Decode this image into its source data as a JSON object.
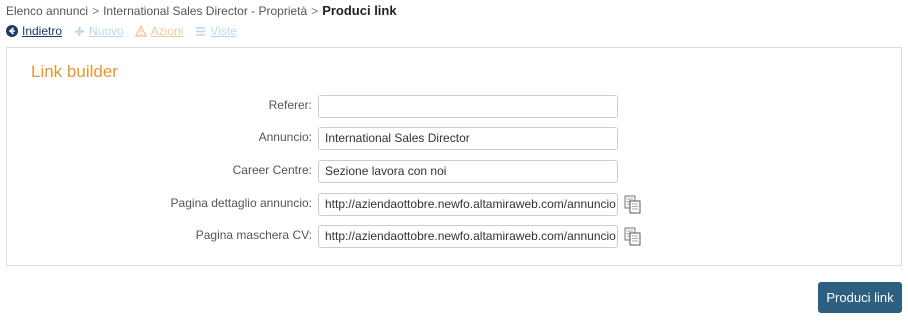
{
  "breadcrumb": {
    "items": [
      "Elenco annunci",
      "International Sales Director - Proprietà"
    ],
    "separator": ">",
    "current": "Produci link"
  },
  "toolbar": {
    "back_label": "Indietro",
    "new_label": "Nuovo",
    "actions_label": "Azioni",
    "views_label": "Viste"
  },
  "panel": {
    "title": "Link builder",
    "fields": [
      {
        "label": "Referer:",
        "value": ""
      },
      {
        "label": "Annuncio:",
        "value": "International Sales Director"
      },
      {
        "label": "Career Centre:",
        "value": "Sezione lavora con noi"
      },
      {
        "label": "Pagina dettaglio annuncio:",
        "value": "http://aziendaottobre.newfo.altamiraweb.com/annuncio"
      },
      {
        "label": "Pagina maschera CV:",
        "value": "http://aziendaottobre.newfo.altamiraweb.com/annuncio"
      }
    ]
  },
  "submit_label": "Produci link",
  "colors": {
    "accent": "#e8962e",
    "primary_button": "#2d5f83",
    "link": "#1a3a6b",
    "disabled_link": "#b9d8ec",
    "disabled_actions": "#f4c89a"
  },
  "icons": {
    "back": "arrow-left-circle-icon",
    "new": "plus-icon",
    "actions": "warning-icon",
    "views": "list-icon",
    "copy": "copy-icon"
  }
}
